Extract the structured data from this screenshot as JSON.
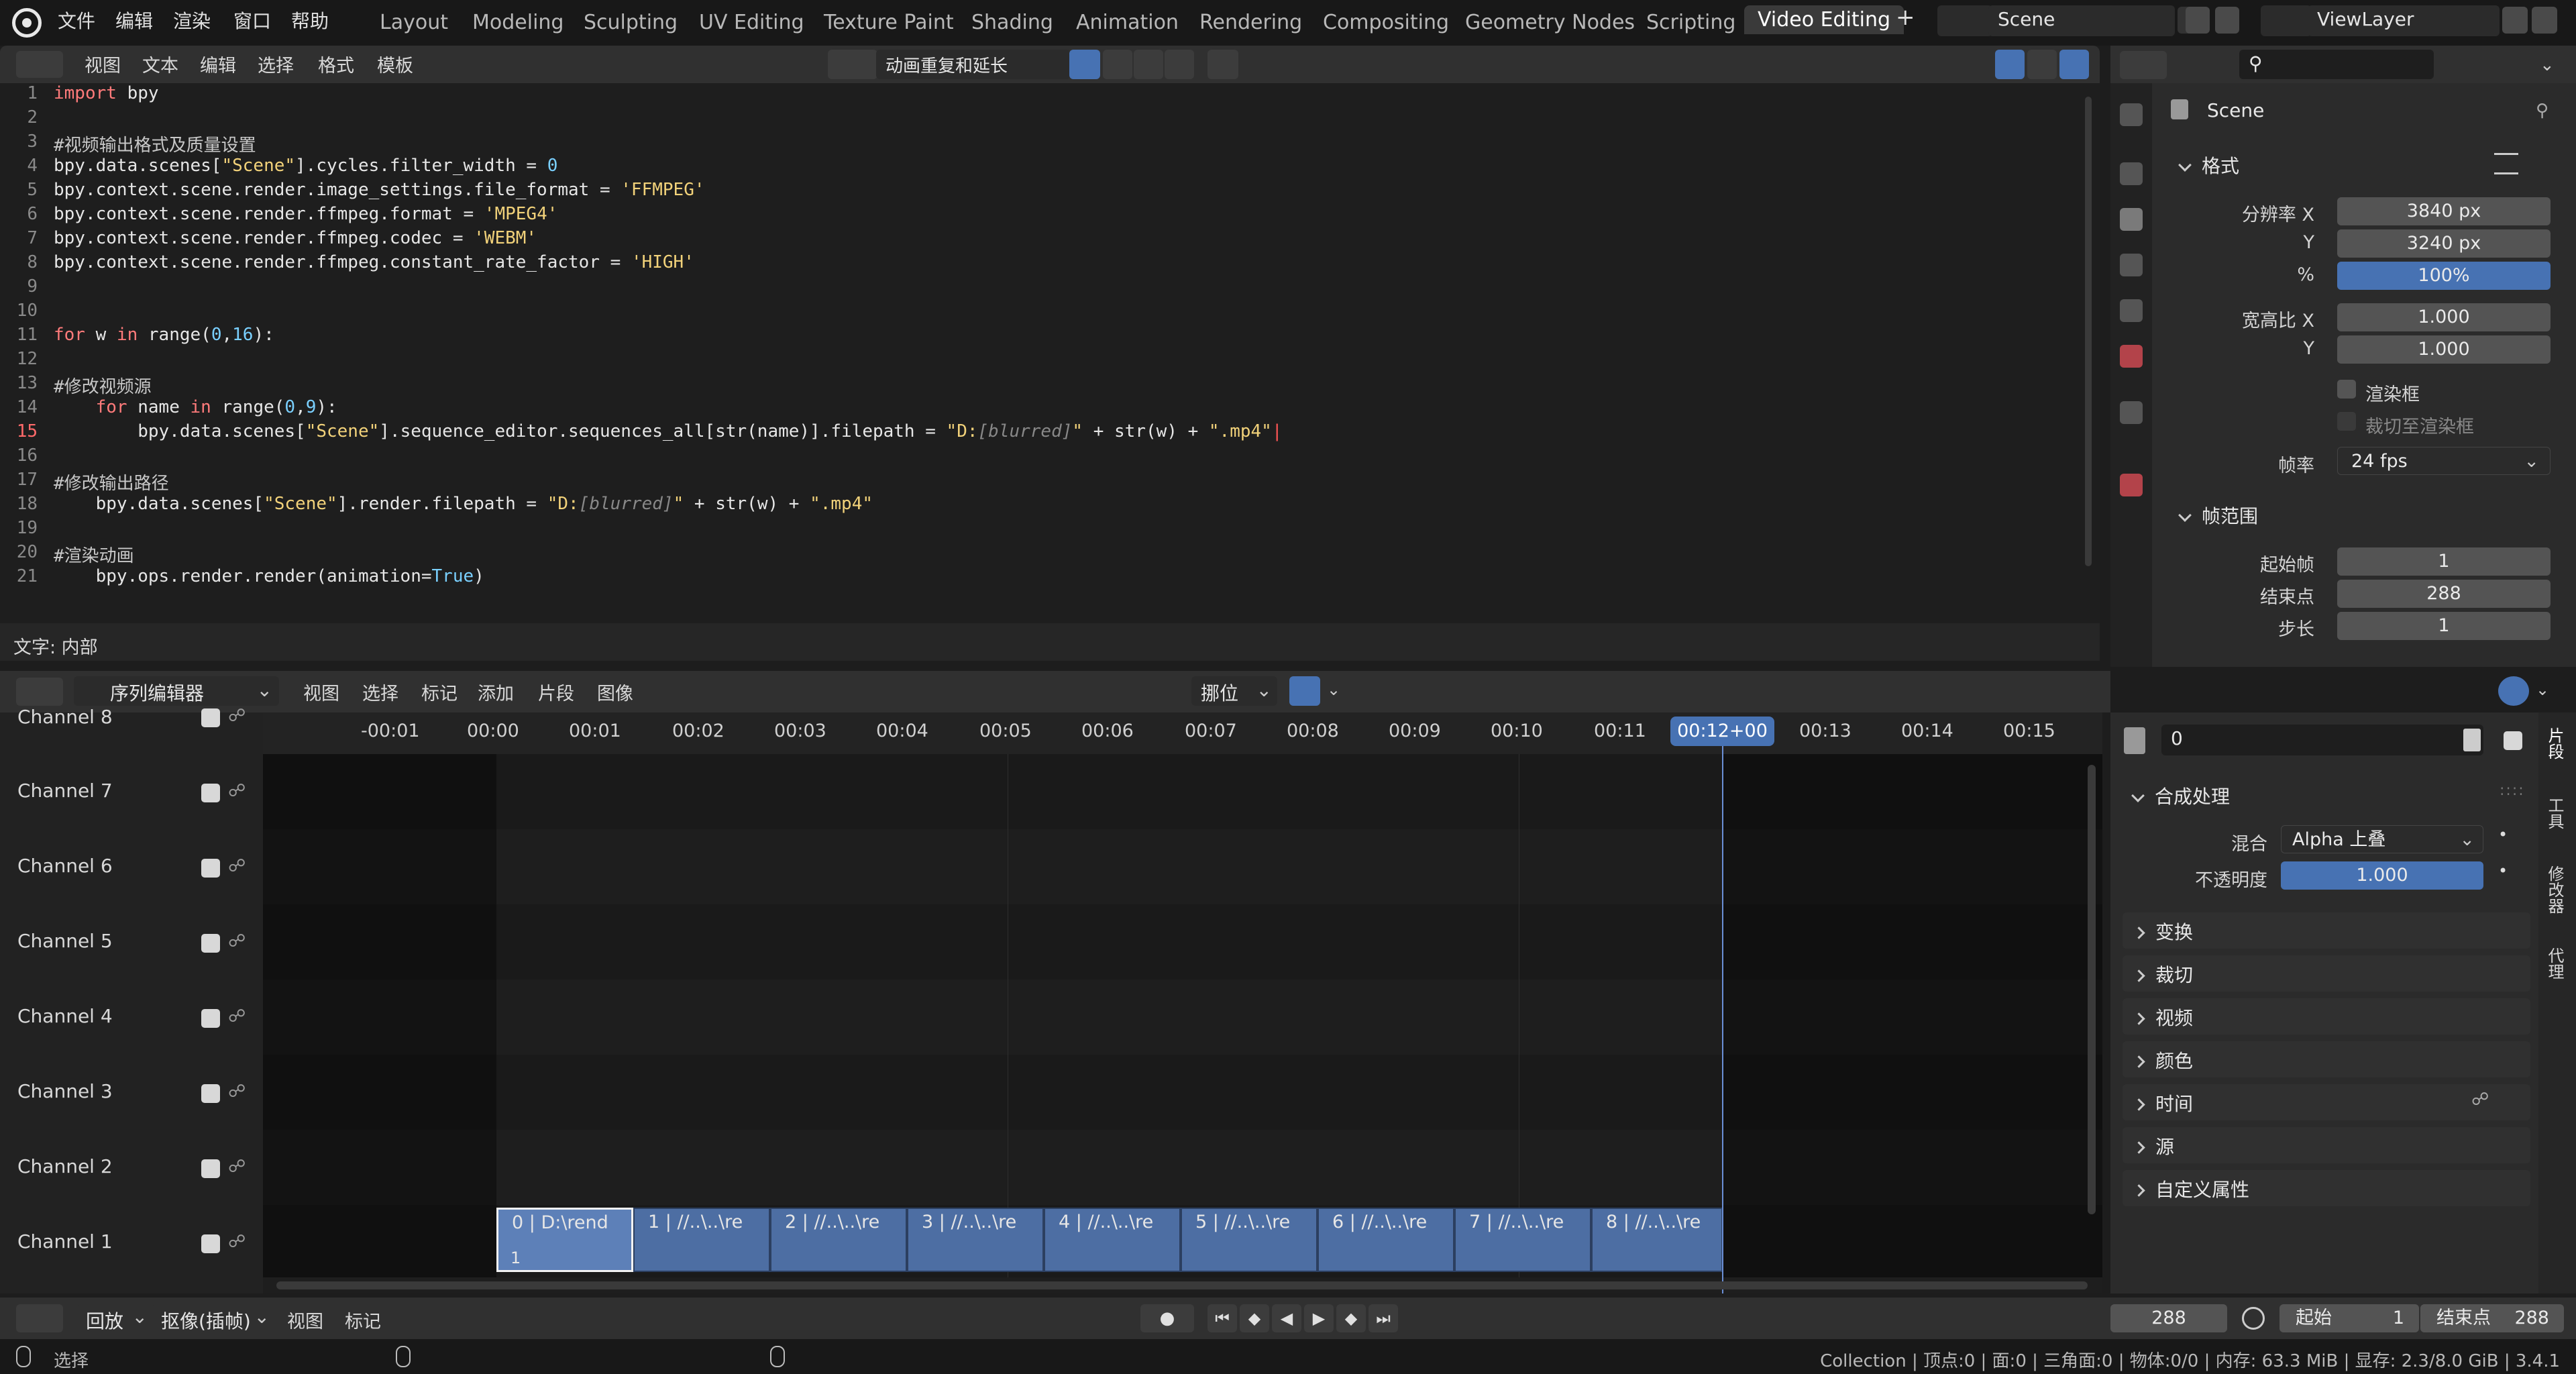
{
  "top_menu": [
    "文件",
    "编辑",
    "渲染",
    "窗口",
    "帮助"
  ],
  "workspaces": [
    "Layout",
    "Modeling",
    "Sculpting",
    "UV Editing",
    "Texture Paint",
    "Shading",
    "Animation",
    "Rendering",
    "Compositing",
    "Geometry Nodes",
    "Scripting",
    "Video Editing"
  ],
  "active_workspace": "Video Editing",
  "add_workspace": "+",
  "scene_name": "Scene",
  "view_layer": "ViewLayer",
  "text_editor": {
    "menu": [
      "视图",
      "文本",
      "编辑",
      "选择",
      "格式",
      "模板"
    ],
    "file_name": "动画重复和延长",
    "status": "文字: 内部",
    "current_line": "15",
    "lines": [
      {
        "n": "1",
        "code": "import bpy"
      },
      {
        "n": "2",
        "code": ""
      },
      {
        "n": "3",
        "code": "#视频输出格式及质量设置"
      },
      {
        "n": "4",
        "code": "bpy.data.scenes[\"Scene\"].cycles.filter_width = 0"
      },
      {
        "n": "5",
        "code": "bpy.context.scene.render.image_settings.file_format = 'FFMPEG'"
      },
      {
        "n": "6",
        "code": "bpy.context.scene.render.ffmpeg.format = 'MPEG4'"
      },
      {
        "n": "7",
        "code": "bpy.context.scene.render.ffmpeg.codec = 'WEBM'"
      },
      {
        "n": "8",
        "code": "bpy.context.scene.render.ffmpeg.constant_rate_factor = 'HIGH'"
      },
      {
        "n": "9",
        "code": ""
      },
      {
        "n": "10",
        "code": ""
      },
      {
        "n": "11",
        "code": "for w in range(0,16):"
      },
      {
        "n": "12",
        "code": ""
      },
      {
        "n": "13",
        "code": "#修改视频源"
      },
      {
        "n": "14",
        "code": "    for name in range(0,9):"
      },
      {
        "n": "15",
        "code": "        bpy.data.scenes[\"Scene\"].sequence_editor.sequences_all[str(name)].filepath = \"D:[blurred]\" + str(w) + \".mp4\""
      },
      {
        "n": "16",
        "code": ""
      },
      {
        "n": "17",
        "code": "#修改输出路径"
      },
      {
        "n": "18",
        "code": "    bpy.data.scenes[\"Scene\"].render.filepath = \"D:[blurred]\" + str(w) + \".mp4\""
      },
      {
        "n": "19",
        "code": ""
      },
      {
        "n": "20",
        "code": "#渲染动画"
      },
      {
        "n": "21",
        "code": "    bpy.ops.render.render(animation=True)"
      }
    ]
  },
  "properties": {
    "context": "Scene",
    "format_panel": "格式",
    "res_x_label": "分辨率 X",
    "res_x": "3840 px",
    "res_y_label": "Y",
    "res_y": "3240 px",
    "res_pct_label": "%",
    "res_pct": "100%",
    "aspect_x_label": "宽高比 X",
    "aspect_x": "1.000",
    "aspect_y_label": "Y",
    "aspect_y": "1.000",
    "render_region": "渲染框",
    "crop_region": "裁切至渲染框",
    "fps_label": "帧率",
    "fps": "24 fps",
    "frame_range_panel": "帧范围",
    "start_label": "起始帧",
    "start": "1",
    "end_label": "结束点",
    "end": "288",
    "step_label": "步长",
    "step": "1"
  },
  "sequencer": {
    "editor_type": "序列编辑器",
    "menu": [
      "视图",
      "选择",
      "标记",
      "添加",
      "片段",
      "图像"
    ],
    "pivot": "挪位",
    "ticks": [
      "-00:01",
      "00:00",
      "00:01",
      "00:02",
      "00:03",
      "00:04",
      "00:05",
      "00:06",
      "00:07",
      "00:08",
      "00:09",
      "00:10",
      "00:11",
      "00:12+00",
      "00:13",
      "00:14",
      "00:15"
    ],
    "playhead": "00:12+00",
    "channels": [
      "Channel 8",
      "Channel 7",
      "Channel 6",
      "Channel 5",
      "Channel 4",
      "Channel 3",
      "Channel 2",
      "Channel 1"
    ],
    "strips": [
      "0 | D:\\rend",
      "1 | //..\\..\\re",
      "2 | //..\\..\\re",
      "3 | //..\\..\\re",
      "4 | //..\\..\\re",
      "5 | //..\\..\\re",
      "6 | //..\\..\\re",
      "7 | //..\\..\\re",
      "8 | //..\\..\\re"
    ],
    "strip_channel_number": "1"
  },
  "strip_panel": {
    "name": "0",
    "compositing": "合成处理",
    "blend_label": "混合",
    "blend": "Alpha 上叠",
    "opacity_label": "不透明度",
    "opacity": "1.000",
    "sections": [
      "变换",
      "裁切",
      "视频",
      "颜色",
      "时间",
      "源",
      "自定义属性"
    ],
    "tabs": [
      "片段",
      "工具",
      "修改器",
      "代理"
    ]
  },
  "timeline": {
    "playback": "回放",
    "keying": "抠像(插帧)",
    "view": "视图",
    "marker": "标记",
    "current_frame": "288",
    "start_label": "起始",
    "start": "1",
    "end_label": "结束点",
    "end": "288"
  },
  "statusbar": {
    "select": "选择",
    "info": "Collection | 顶点:0 | 面:0 | 三角面:0 | 物体:0/0 | 内存: 63.3 MiB | 显存: 2.3/8.0 GiB | 3.4.1"
  },
  "colors": {
    "accent": "#4772b3",
    "strip": "#4d6ea3",
    "playhead": "#6b8fd6"
  }
}
